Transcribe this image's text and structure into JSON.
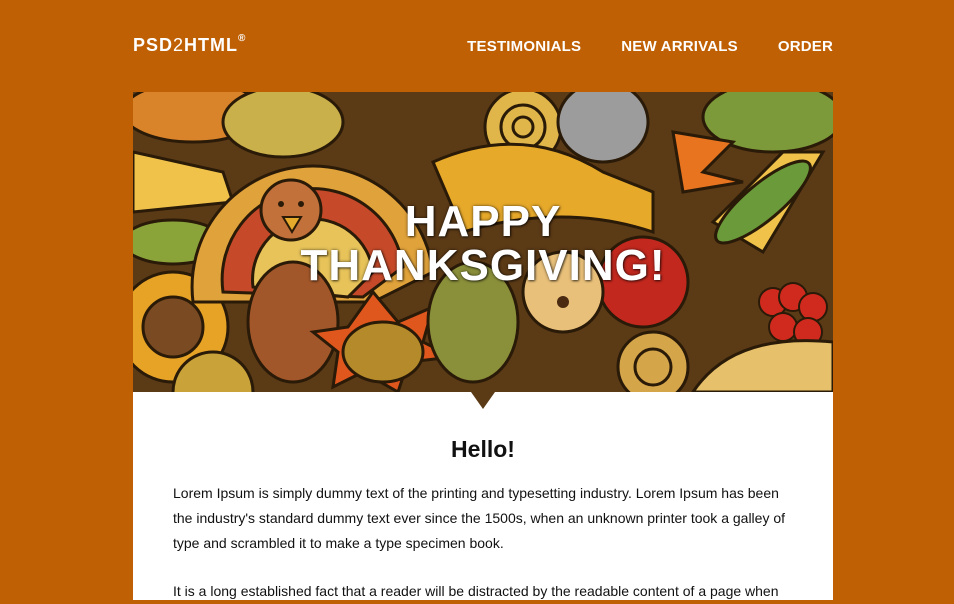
{
  "header": {
    "logo_main": "PSD",
    "logo_two": "2",
    "logo_rest": "HTML",
    "logo_reg": "®",
    "nav": [
      {
        "label": "TESTIMONIALS"
      },
      {
        "label": "NEW ARRIVALS"
      },
      {
        "label": "ORDER"
      }
    ]
  },
  "hero": {
    "title_line1": "HAPPY",
    "title_line2": "THANKSGIVING!"
  },
  "content": {
    "greeting": "Hello!",
    "paragraph1": "Lorem Ipsum is simply dummy text of the printing and typesetting industry. Lorem Ipsum has been the industry's standard dummy text ever since the 1500s, when an unknown printer took a galley of type and scrambled it to make a type specimen book.",
    "paragraph2": "It is a long established fact that a reader will be distracted by the readable content of a page when"
  },
  "colors": {
    "background": "#bf6005",
    "panel": "#ffffff",
    "text": "#111111"
  }
}
